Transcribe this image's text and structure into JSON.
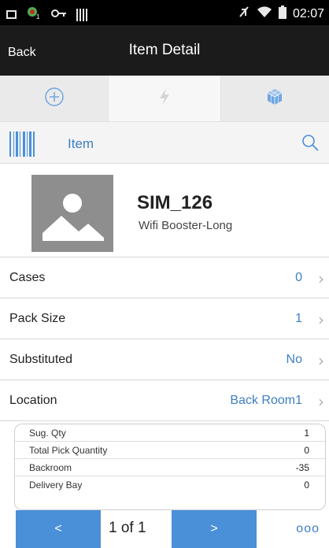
{
  "status_bar": {
    "time": "02:07"
  },
  "header": {
    "back_label": "Back",
    "title": "Item Detail"
  },
  "tabs": [
    {
      "icon": "plus-circle-icon",
      "active": false
    },
    {
      "icon": "lightning-icon",
      "active": true
    },
    {
      "icon": "cube-icon",
      "active": false
    }
  ],
  "scan": {
    "label": "Item"
  },
  "item": {
    "id": "SIM_126",
    "description": "Wifi Booster-Long"
  },
  "details": [
    {
      "label": "Cases",
      "value": "0"
    },
    {
      "label": "Pack Size",
      "value": "1"
    },
    {
      "label": "Substituted",
      "value": "No"
    },
    {
      "label": "Location",
      "value": "Back Room1"
    }
  ],
  "summary": [
    {
      "label": "Sug. Qty",
      "value": "1"
    },
    {
      "label": "Total Pick Quantity",
      "value": "0"
    },
    {
      "label": "Backroom",
      "value": "-35"
    },
    {
      "label": "Delivery Bay",
      "value": "0"
    }
  ],
  "pager": {
    "prev_label": "<",
    "next_label": ">",
    "indicator": "1 of 1",
    "more_label": "ooo"
  },
  "colors": {
    "accent": "#4a90d9",
    "title_bar": "#1b1b1b",
    "link": "#3d7fc4"
  }
}
